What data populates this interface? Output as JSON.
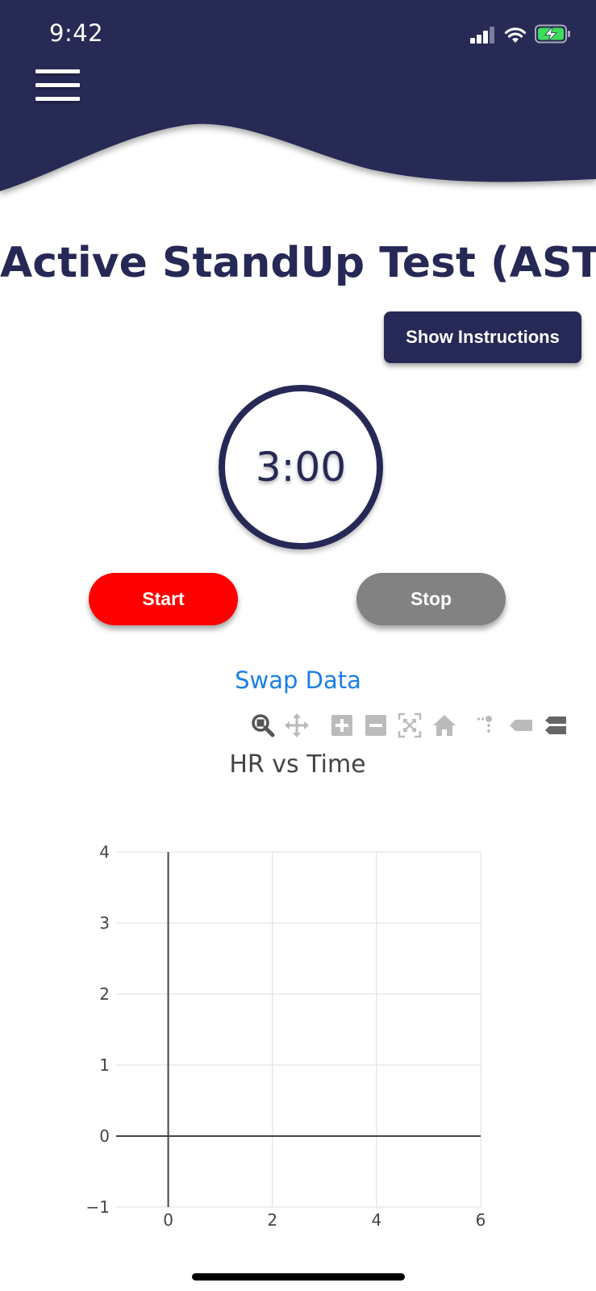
{
  "status_bar": {
    "time": "9:42"
  },
  "header": {
    "menu_icon": "hamburger-menu-icon"
  },
  "page": {
    "title": "Active StandUp Test (AST)"
  },
  "instructions_button": {
    "label": "Show Instructions"
  },
  "timer": {
    "value": "3:00"
  },
  "controls": {
    "start_label": "Start",
    "stop_label": "Stop"
  },
  "swap_link": {
    "label": "Swap Data"
  },
  "modebar": {
    "icons": [
      "zoom-icon",
      "pan-icon",
      "zoom-in-icon",
      "zoom-out-icon",
      "autoscale-icon",
      "reset-axes-icon",
      "toggle-spikelines-icon",
      "hover-closest-icon",
      "hover-compare-icon"
    ]
  },
  "colors": {
    "navy": "#262955",
    "start_red": "#ff0000",
    "stop_gray": "#828282",
    "link_blue": "#1a7fe6"
  },
  "chart_data": {
    "type": "line",
    "title": "HR vs Time",
    "xlabel": "",
    "ylabel": "",
    "xlim": [
      -1,
      6
    ],
    "ylim": [
      -1,
      4
    ],
    "x_ticks": [
      0,
      2,
      4,
      6
    ],
    "y_ticks": [
      -1,
      0,
      1,
      2,
      3,
      4
    ],
    "x_tick_labels": [
      "0",
      "2",
      "4",
      "6"
    ],
    "y_tick_labels": [
      "−1",
      "0",
      "1",
      "2",
      "3",
      "4"
    ],
    "grid": true,
    "series": []
  }
}
